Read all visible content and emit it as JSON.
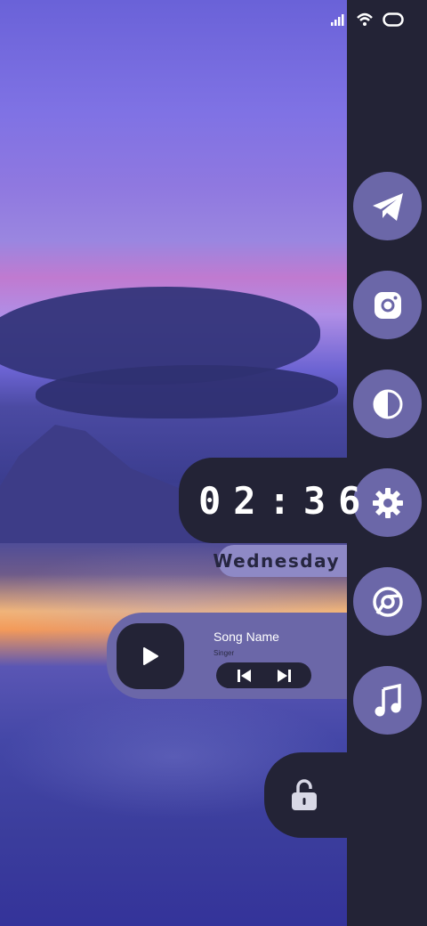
{
  "clock": {
    "time": "02:36",
    "day": "Wednesday"
  },
  "music": {
    "song_name": "Song Name",
    "singer": "Singer"
  },
  "apps": [
    {
      "icon": "telegram-icon"
    },
    {
      "icon": "instagram-icon"
    },
    {
      "icon": "contrast-icon"
    },
    {
      "icon": "settings-gear-icon"
    },
    {
      "icon": "chrome-icon"
    },
    {
      "icon": "music-note-icon"
    }
  ],
  "colors": {
    "panel": "#232336",
    "accent": "#6b67a8",
    "day_tag": "#8e89c6",
    "white": "#ffffff"
  },
  "status_icons": [
    "signal-icon",
    "wifi-icon",
    "battery-icon"
  ]
}
